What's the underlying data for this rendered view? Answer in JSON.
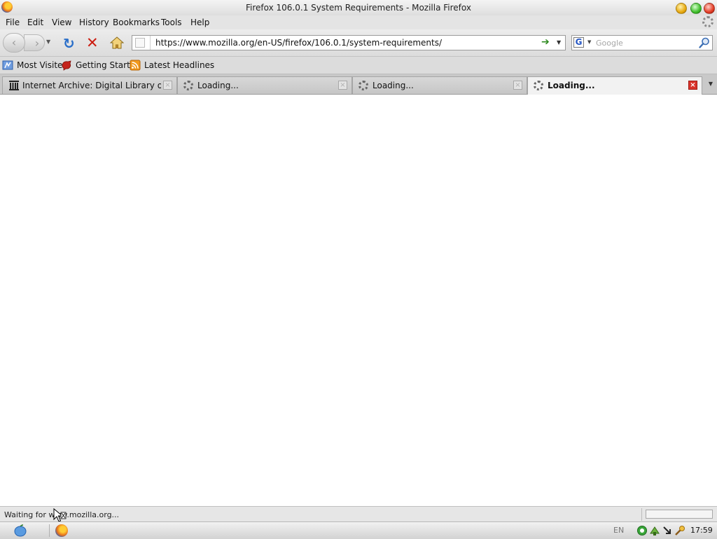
{
  "window": {
    "title": "Firefox 106.0.1 System Requirements - Mozilla Firefox"
  },
  "menu": {
    "items": [
      {
        "label": "File"
      },
      {
        "label": "Edit"
      },
      {
        "label": "View"
      },
      {
        "label": "History"
      },
      {
        "label": "Bookmarks"
      },
      {
        "label": "Tools"
      },
      {
        "label": "Help"
      }
    ]
  },
  "navbar": {
    "url": "https://www.mozilla.org/en-US/firefox/106.0.1/system-requirements/",
    "search_placeholder": "Google",
    "search_engine_icon": "google-icon"
  },
  "bookmarks": {
    "items": [
      {
        "label": "Most Visited",
        "icon": "most-visited-icon"
      },
      {
        "label": "Getting Started",
        "icon": "getting-started-icon"
      },
      {
        "label": "Latest Headlines",
        "icon": "rss-feed-icon"
      }
    ]
  },
  "tabs": [
    {
      "label": "Internet Archive: Digital Library of Free & ...",
      "icon": "internet-archive-icon",
      "active": false
    },
    {
      "label": "Loading...",
      "icon": "loading-spinner-icon",
      "active": false
    },
    {
      "label": "Loading...",
      "icon": "loading-spinner-icon",
      "active": false
    },
    {
      "label": "Loading...",
      "icon": "loading-spinner-icon",
      "active": true
    }
  ],
  "status": {
    "text": "Waiting for www.mozilla.org..."
  },
  "taskbar": {
    "language": "EN",
    "clock": "17:59"
  },
  "colors": {
    "reload": "#2a6fc9",
    "stop": "#cc1c10",
    "go": "#2e8a1f",
    "active_tab_close": "#d9332a"
  }
}
